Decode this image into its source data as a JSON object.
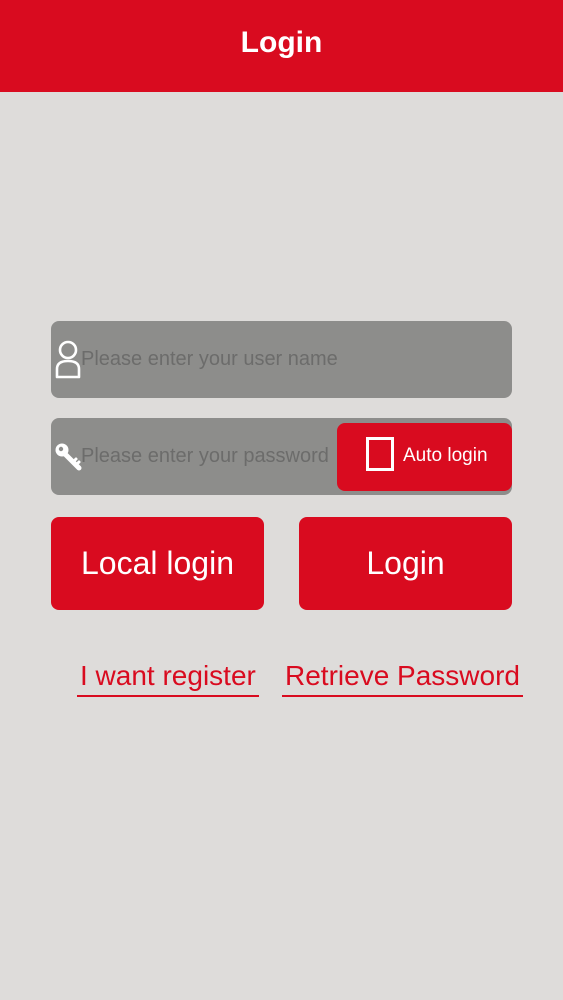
{
  "header": {
    "title": "Login"
  },
  "username_field": {
    "icon": "user-icon",
    "placeholder": "Please enter your user name",
    "value": ""
  },
  "password_field": {
    "icon": "key-icon",
    "placeholder": "Please enter your password",
    "value": ""
  },
  "auto_login": {
    "label": "Auto login",
    "checked": false
  },
  "buttons": {
    "local_login": "Local login",
    "login": "Login"
  },
  "links": {
    "register": "I want register",
    "retrieve_password": "Retrieve Password"
  },
  "colors": {
    "accent": "#d90b1f",
    "background": "#dedcda",
    "field": "#8d8d8b"
  }
}
